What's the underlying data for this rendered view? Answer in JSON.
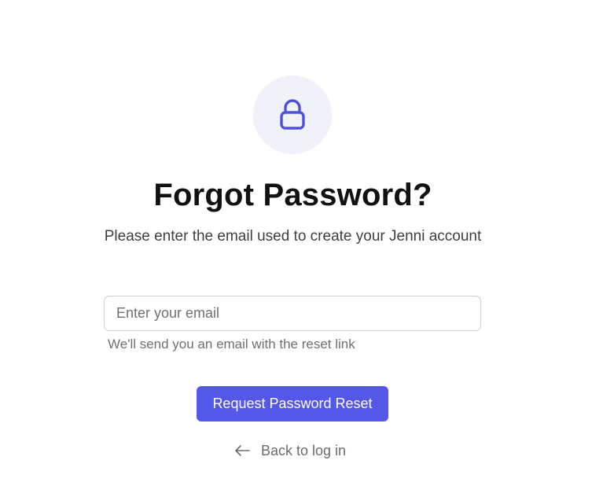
{
  "header": {
    "icon": "lock-icon",
    "title": "Forgot Password?",
    "subtitle": "Please enter the email used to create your Jenni account"
  },
  "form": {
    "email_placeholder": "Enter your email",
    "email_value": "",
    "helper_text": "We'll send you an email with the reset link",
    "submit_label": "Request Password Reset"
  },
  "footer": {
    "back_icon": "arrow-left-icon",
    "back_label": "Back to log in"
  },
  "colors": {
    "accent": "#5557e8",
    "icon": "#4f52d9",
    "icon_circle_bg": "#f0f1f9"
  }
}
